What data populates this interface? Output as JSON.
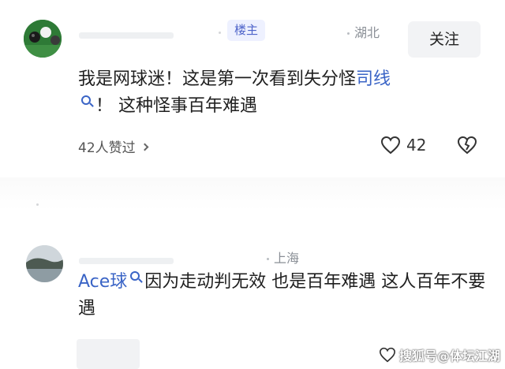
{
  "comment1": {
    "username": "",
    "badge": "楼主",
    "location": "湖北",
    "follow_label": "关注",
    "text_before_link": "我是网球迷！这是第一次看到失分怪",
    "link_text": "司线",
    "text_after_link": "！ 这种怪事百年难遇",
    "likers": "42人赞过",
    "like_count": "42"
  },
  "comment2": {
    "username": "",
    "location": "上海",
    "link_text": "Ace球",
    "text": "因为走动判无效 也是百年难遇 这人百年不要遇"
  },
  "watermark": {
    "text": "搜狐号@体坛江湖"
  },
  "colors": {
    "link": "#3a64c6",
    "badge_bg": "#eef1ff",
    "badge_text": "#4d63c9",
    "follow_bg": "#f2f3f5"
  }
}
